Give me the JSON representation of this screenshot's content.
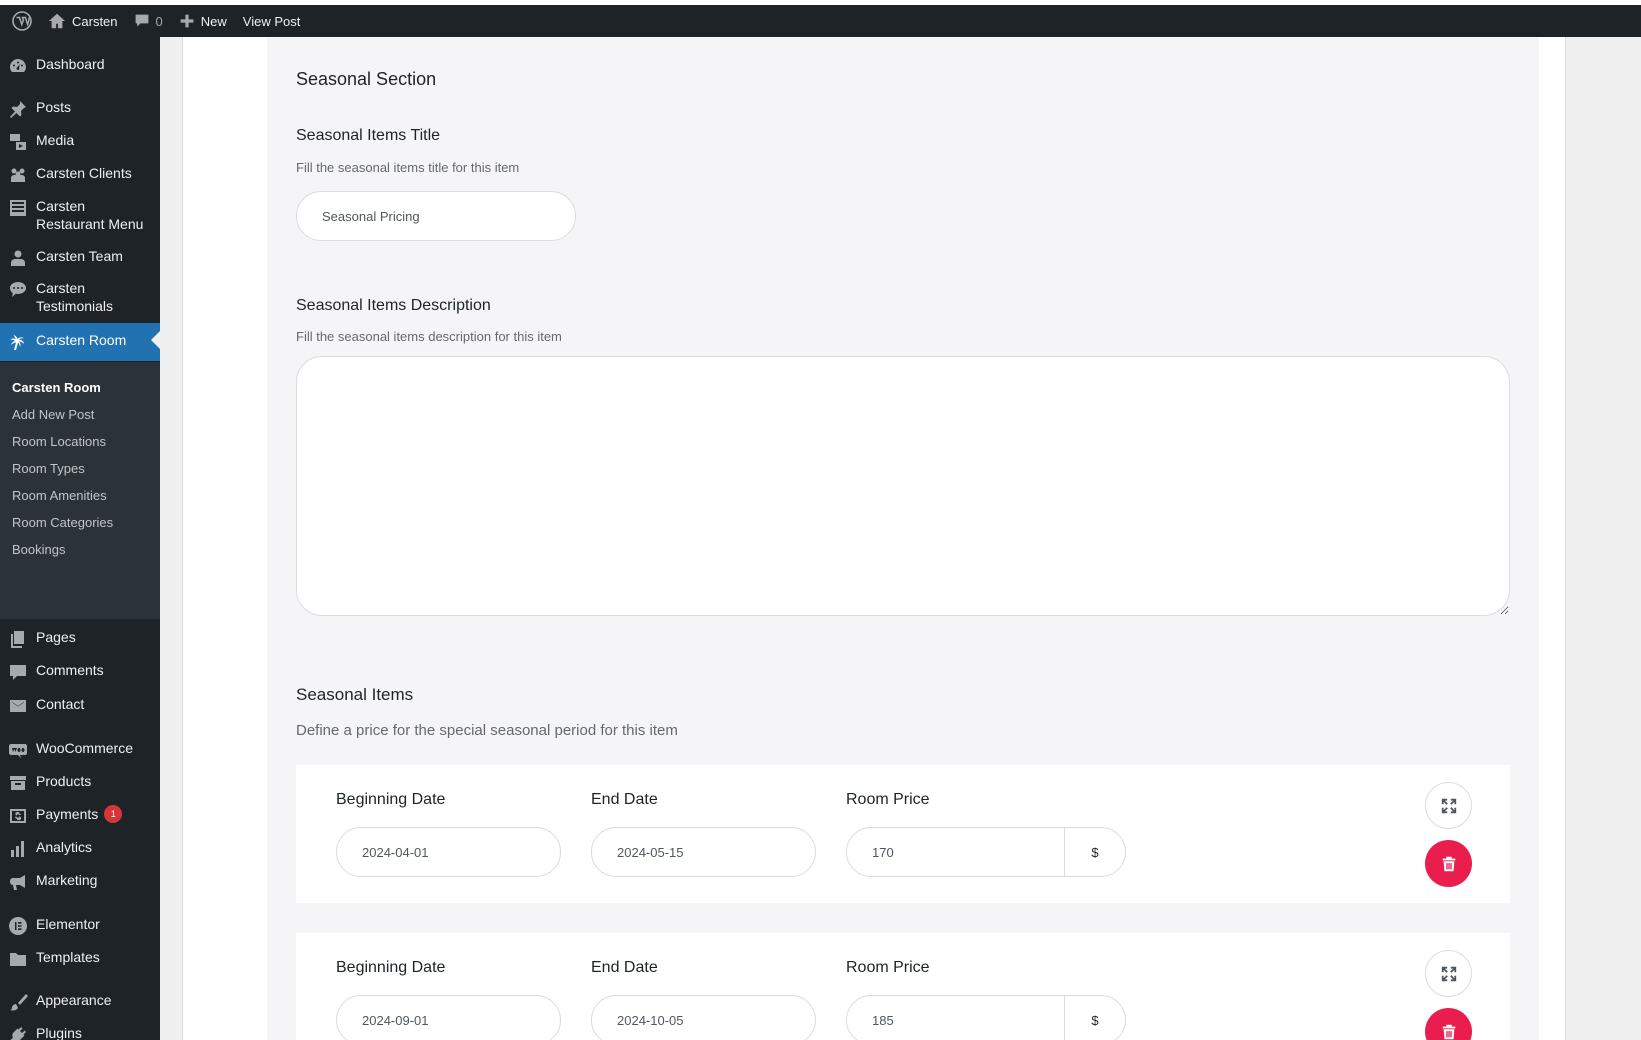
{
  "adminbar": {
    "site_name": "Carsten",
    "comments_count": "0",
    "new_label": "New",
    "view_post_label": "View Post"
  },
  "sidebar": {
    "items": [
      {
        "label": "Dashboard",
        "icon": "dashboard-icon"
      },
      {
        "label": "Posts",
        "icon": "pin-icon"
      },
      {
        "label": "Media",
        "icon": "media-icon"
      },
      {
        "label": "Carsten Clients",
        "icon": "groups-icon"
      },
      {
        "label": "Carsten Restaurant Menu",
        "icon": "list-icon"
      },
      {
        "label": "Carsten Team",
        "icon": "person-icon"
      },
      {
        "label": "Carsten Testimonials",
        "icon": "chat-bubble-icon"
      },
      {
        "label": "Carsten Room",
        "icon": "palm-tree-icon"
      },
      {
        "label": "Pages",
        "icon": "pages-icon"
      },
      {
        "label": "Comments",
        "icon": "comment-icon"
      },
      {
        "label": "Contact",
        "icon": "mail-icon"
      },
      {
        "label": "WooCommerce",
        "icon": "woo-icon"
      },
      {
        "label": "Products",
        "icon": "archive-icon"
      },
      {
        "label": "Payments",
        "icon": "dollar-icon",
        "badge": "1"
      },
      {
        "label": "Analytics",
        "icon": "bar-chart-icon"
      },
      {
        "label": "Marketing",
        "icon": "megaphone-icon"
      },
      {
        "label": "Elementor",
        "icon": "elementor-icon"
      },
      {
        "label": "Templates",
        "icon": "folder-icon"
      },
      {
        "label": "Appearance",
        "icon": "brush-icon"
      },
      {
        "label": "Plugins",
        "icon": "plug-icon"
      }
    ],
    "submenu": [
      "Carsten Room",
      "Add New Post",
      "Room Locations",
      "Room Types",
      "Room Amenities",
      "Room Categories",
      "Bookings"
    ]
  },
  "main": {
    "section_title": "Seasonal Section",
    "items_title": {
      "label": "Seasonal Items Title",
      "help": "Fill the seasonal items title for this item",
      "value": "Seasonal Pricing"
    },
    "items_description": {
      "label": "Seasonal Items Description",
      "help": "Fill the seasonal items description for this item",
      "value": ""
    },
    "seasonal_items": {
      "label": "Seasonal Items",
      "help": "Define a price for the special seasonal period for this item",
      "col_begin": "Beginning Date",
      "col_end": "End Date",
      "col_price": "Room Price",
      "rows": [
        {
          "begin": "2024-04-01",
          "end": "2024-05-15",
          "price": "170",
          "currency": "$"
        },
        {
          "begin": "2024-09-01",
          "end": "2024-10-05",
          "price": "185",
          "currency": "$"
        }
      ]
    }
  },
  "colors": {
    "admin_dark": "#1d2327",
    "accent_blue": "#2271b1",
    "delete_red": "#e91e4f",
    "badge_red": "#d63638"
  }
}
